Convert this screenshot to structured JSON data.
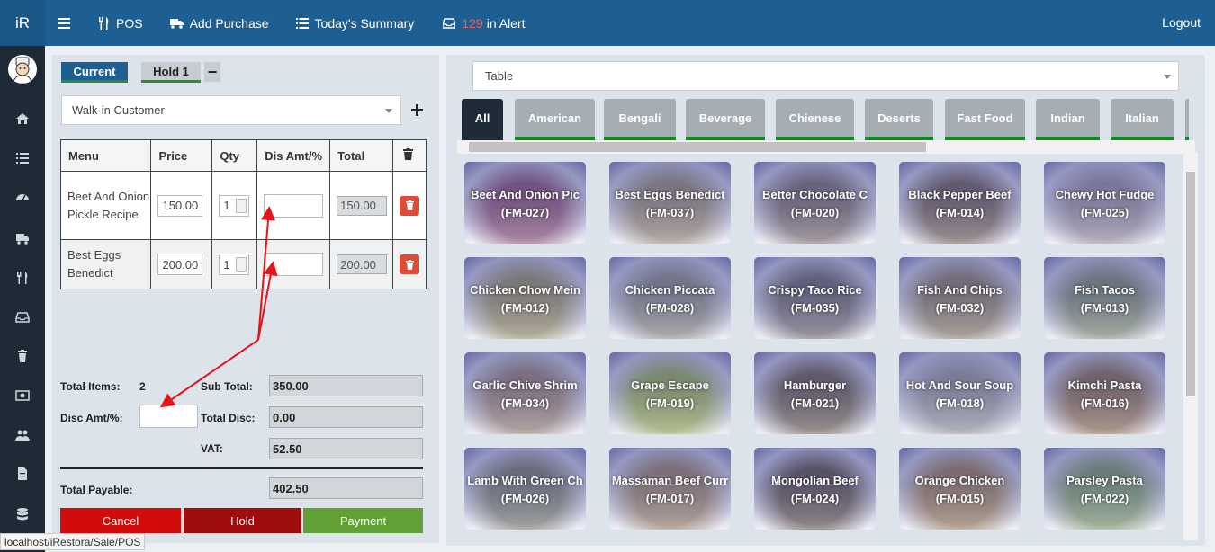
{
  "app": {
    "logo": "iR"
  },
  "topbar": {
    "menu_icon": "hamburger-icon",
    "items": [
      {
        "label": "POS",
        "icon": "cutlery-icon"
      },
      {
        "label": "Add Purchase",
        "icon": "truck-icon"
      },
      {
        "label": "Today's Summary",
        "icon": "list-icon"
      },
      {
        "label": "in Alert",
        "icon": "inbox-icon",
        "count": "129"
      }
    ],
    "logout": "Logout"
  },
  "sidebar": {
    "icons": [
      "home-icon",
      "list-icon",
      "dashboard-icon",
      "truck-icon",
      "cutlery-icon",
      "inbox-icon",
      "trash-icon",
      "money-icon",
      "users-icon",
      "file-icon",
      "database-icon"
    ]
  },
  "order": {
    "tabs": {
      "current": "Current",
      "hold": "Hold 1",
      "remove": "−"
    },
    "customer": "Walk-in Customer",
    "columns": [
      "Menu",
      "Price",
      "Qty",
      "Dis Amt/%",
      "Total"
    ],
    "rows": [
      {
        "menu": "Beet And Onion Pickle Recipe",
        "price": "150.00",
        "qty": "1",
        "total": "150.00"
      },
      {
        "menu": "Best Eggs Benedict",
        "price": "200.00",
        "qty": "1",
        "total": "200.00"
      }
    ],
    "summary": {
      "total_items_label": "Total Items:",
      "total_items": "2",
      "sub_total_label": "Sub Total:",
      "sub_total": "350.00",
      "disc_label": "Disc Amt/%:",
      "total_disc_label": "Total Disc:",
      "total_disc": "0.00",
      "vat_label": "VAT:",
      "vat": "52.50",
      "total_payable_label": "Total Payable:",
      "total_payable": "402.50"
    },
    "buttons": {
      "cancel": "Cancel",
      "hold": "Hold",
      "payment": "Payment"
    }
  },
  "status_url": "localhost/iRestora/Sale/POS",
  "menu_panel": {
    "table_select": "Table",
    "categories": [
      "All",
      "American",
      "Bengali",
      "Beverage",
      "Chienese",
      "Deserts",
      "Fast Food",
      "Indian",
      "Italian"
    ],
    "active_category": "All",
    "items": [
      {
        "name": "Beet And Onion Pic",
        "code": "(FM-027)"
      },
      {
        "name": "Best Eggs Benedict",
        "code": "(FM-037)"
      },
      {
        "name": "Better Chocolate C",
        "code": "(FM-020)"
      },
      {
        "name": "Black Pepper Beef",
        "code": "(FM-014)"
      },
      {
        "name": "Chewy Hot Fudge",
        "code": "(FM-025)"
      },
      {
        "name": "Chicken Chow Mein",
        "code": "(FM-012)"
      },
      {
        "name": "Chicken Piccata",
        "code": "(FM-028)"
      },
      {
        "name": "Crispy Taco Rice",
        "code": "(FM-035)"
      },
      {
        "name": "Fish And Chips",
        "code": "(FM-032)"
      },
      {
        "name": "Fish Tacos",
        "code": "(FM-013)"
      },
      {
        "name": "Garlic Chive Shrim",
        "code": "(FM-034)"
      },
      {
        "name": "Grape Escape",
        "code": "(FM-019)"
      },
      {
        "name": "Hamburger",
        "code": "(FM-021)"
      },
      {
        "name": "Hot And Sour Soup",
        "code": "(FM-018)"
      },
      {
        "name": "Kimchi Pasta",
        "code": "(FM-016)"
      },
      {
        "name": "Lamb With Green Ch",
        "code": "(FM-026)"
      },
      {
        "name": "Massaman Beef Curr",
        "code": "(FM-017)"
      },
      {
        "name": "Mongolian Beef",
        "code": "(FM-024)"
      },
      {
        "name": "Orange Chicken",
        "code": "(FM-015)"
      },
      {
        "name": "Parsley Pasta",
        "code": "(FM-022)"
      }
    ]
  },
  "colors": {
    "topbar": "#1e5f93",
    "sidebar": "#1e2a36",
    "annotation_arrow": "#e5141b",
    "category_underline": "#0c8a22"
  }
}
